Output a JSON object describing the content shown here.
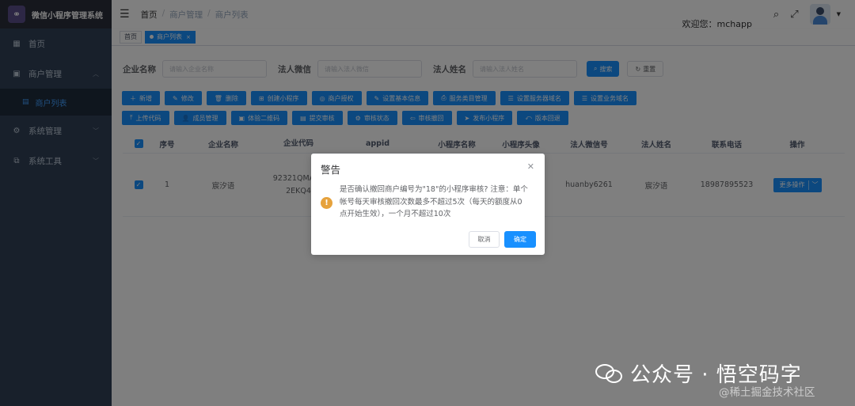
{
  "app": {
    "title": "微信小程序管理系统"
  },
  "sidebar": {
    "items": [
      {
        "label": "首页",
        "icon": "dashboard-icon"
      },
      {
        "label": "商户管理",
        "icon": "store-icon"
      },
      {
        "label": "商户列表",
        "icon": "list-icon"
      },
      {
        "label": "系统管理",
        "icon": "gear-icon"
      },
      {
        "label": "系统工具",
        "icon": "toolbox-icon"
      }
    ]
  },
  "header": {
    "breadcrumb": [
      "首页",
      "商户管理",
      "商户列表"
    ],
    "welcome": "欢迎您：mchapp"
  },
  "tags": [
    {
      "label": "首页"
    },
    {
      "label": "商户列表"
    }
  ],
  "search": {
    "fields": [
      {
        "label": "企业名称",
        "placeholder": "请输入企业名称"
      },
      {
        "label": "法人微信",
        "placeholder": "请输入法人微信"
      },
      {
        "label": "法人姓名",
        "placeholder": "请输入法人姓名"
      }
    ],
    "search_label": "搜索",
    "reset_label": "重置"
  },
  "toolbar": {
    "row1": [
      "新增",
      "修改",
      "删除",
      "创建小程序",
      "商户授权",
      "设置基本信息",
      "服务类目管理",
      "设置服务器域名",
      "设置业务域名"
    ],
    "row2": [
      "上传代码",
      "成员管理",
      "体验二维码",
      "提交审核",
      "审核状态",
      "审核撤回",
      "发布小程序",
      "版本回退"
    ]
  },
  "table": {
    "headers": [
      "序号",
      "企业名称",
      "企业代码",
      "appid",
      "小程序名称",
      "小程序头像",
      "法人微信号",
      "法人姓名",
      "联系电话",
      "操作"
    ],
    "rows": [
      {
        "index": "1",
        "company": "宸汐语",
        "code_line1": "92321QMA34",
        "code_line2": "2EKQ4",
        "wechat": "huanby6261",
        "legal_name": "宸汐语",
        "phone": "18987895523",
        "action": "更多操作"
      }
    ]
  },
  "dialog": {
    "title": "警告",
    "message": "是否确认撤回商户编号为\"18\"的小程序审核? 注意：单个帐号每天审核撤回次数最多不超过5次（每天的额度从0点开始生效），一个月不超过10次",
    "cancel": "取消",
    "confirm": "确定"
  },
  "watermark": {
    "line1": "公众号 · 悟空码字",
    "line2": "@稀土掘金技术社区"
  }
}
